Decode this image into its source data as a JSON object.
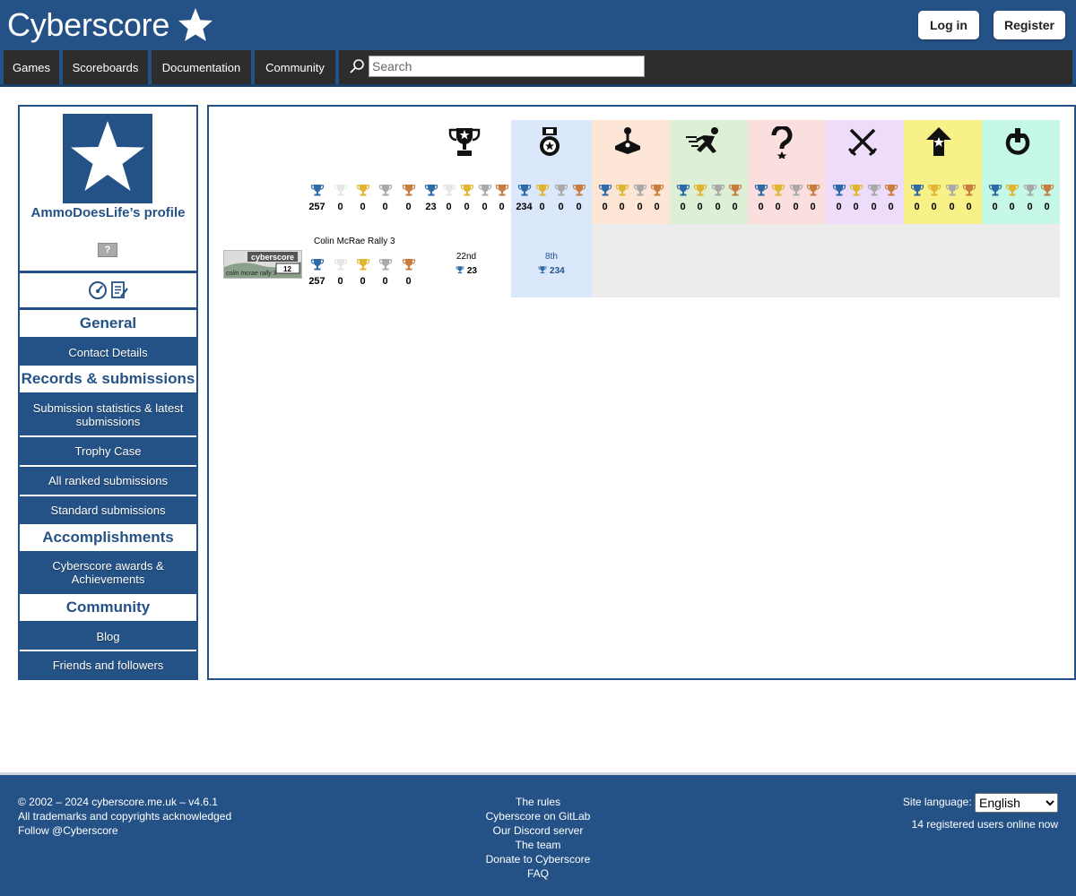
{
  "header": {
    "site_name": "Cyberscore",
    "login_label": "Log in",
    "register_label": "Register"
  },
  "nav": {
    "items": [
      {
        "label": "Games"
      },
      {
        "label": "Scoreboards"
      },
      {
        "label": "Documentation"
      },
      {
        "label": "Community"
      }
    ],
    "search_placeholder": "Search"
  },
  "sidebar": {
    "profile_name": "AmmoDoesLife’s profile",
    "help_badge": "?",
    "sections": [
      {
        "title": "General",
        "links": [
          "Contact Details"
        ]
      },
      {
        "title": "Records & submissions",
        "links": [
          "Submission statistics & latest submissions",
          "Trophy Case",
          "All ranked submissions",
          "Standard submissions"
        ]
      },
      {
        "title": "Accomplishments",
        "links": [
          "Cyberscore awards & Achievements"
        ]
      },
      {
        "title": "Community",
        "links": [
          "Blog",
          "Friends and followers"
        ]
      }
    ]
  },
  "trophy_table": {
    "colors": {
      "platinum": "#2e6aa6",
      "white": "#e6e6e6",
      "gold": "#e0b531",
      "silver": "#a9a9a9",
      "bronze": "#c87c3e"
    },
    "category_backgrounds": [
      "#dbe8fb",
      "#fde6d6",
      "#ddf0d6",
      "#fbdede",
      "#eedcfb",
      "#f8f188",
      "#c5f8e6"
    ],
    "category_icons": [
      "trophy-icon",
      "medal-icon",
      "joystick-icon",
      "speedrun-icon",
      "question-icon",
      "swords-icon",
      "arrow-up-icon",
      "power-icon"
    ],
    "totals": {
      "overall": [
        "257",
        "0",
        "0",
        "0",
        "0"
      ],
      "ranked": [
        "23",
        "0",
        "0",
        "0",
        "0"
      ],
      "categories": [
        [
          "234",
          "0",
          "0",
          "0"
        ],
        [
          "0",
          "0",
          "0",
          "0"
        ],
        [
          "0",
          "0",
          "0",
          "0"
        ],
        [
          "0",
          "0",
          "0",
          "0"
        ],
        [
          "0",
          "0",
          "0",
          "0"
        ],
        [
          "0",
          "0",
          "0",
          "0"
        ],
        [
          "0",
          "0",
          "0",
          "0"
        ]
      ]
    },
    "game": {
      "title": "Colin McRae Rally 3",
      "thumb_logo": "cyberscore",
      "thumb_count": "12",
      "thumb_caption": "colin mcrae rally 3",
      "counts": [
        "257",
        "0",
        "0",
        "0",
        "0"
      ],
      "overall_position": "22nd",
      "overall_medal_value": "23",
      "category_position": "8th",
      "category_medal_value": "234"
    }
  },
  "footer": {
    "left": [
      "© 2002 – 2024 cyberscore.me.uk – v4.6.1",
      "All trademarks and copyrights acknowledged",
      "Follow @Cyberscore"
    ],
    "links": [
      "The rules",
      "Cyberscore on GitLab",
      "Our Discord server",
      "The team",
      "Donate to Cyberscore",
      "FAQ"
    ],
    "language_label": "Site language:",
    "language_value": "English",
    "users_online": "14 registered users online now"
  }
}
